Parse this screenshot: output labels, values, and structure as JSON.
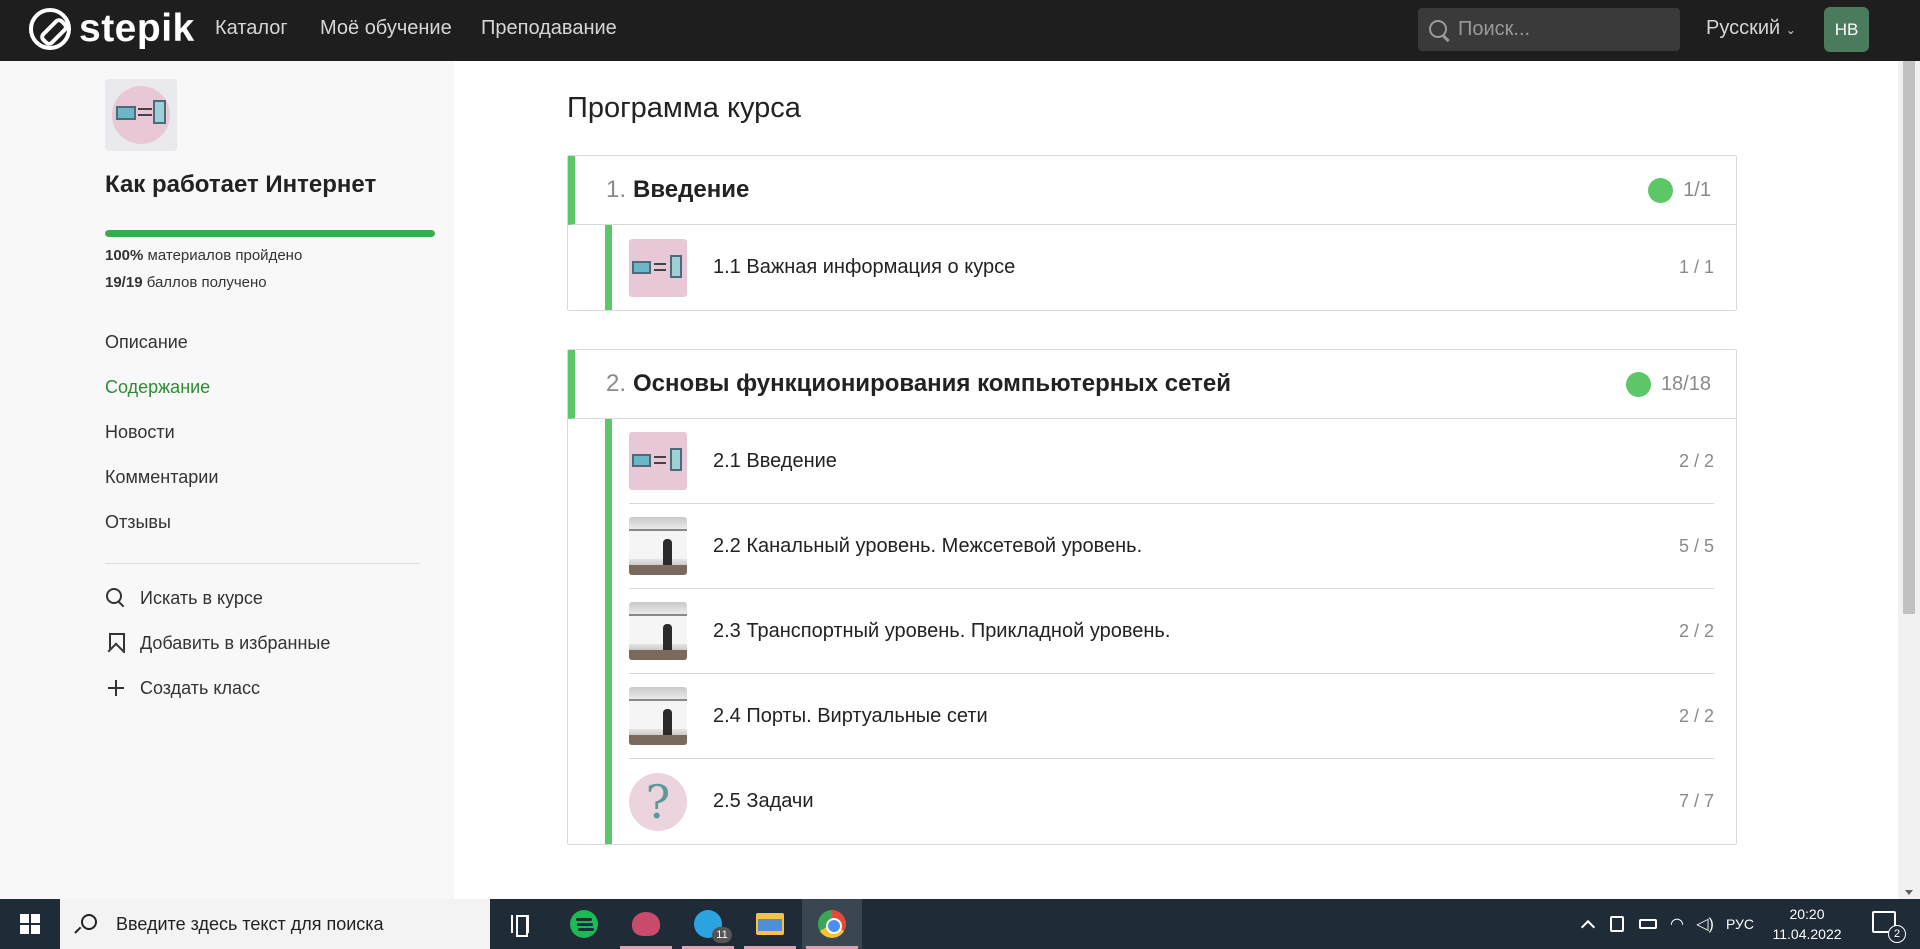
{
  "header": {
    "logo_text": "stepik",
    "nav": [
      "Каталог",
      "Моё обучение",
      "Преподавание"
    ],
    "search_placeholder": "Поиск...",
    "language": "Русский",
    "avatar_initials": "НВ"
  },
  "sidebar": {
    "course_title": "Как работает Интернет",
    "progress_percent": 100,
    "materials_value": "100%",
    "materials_text": "материалов пройдено",
    "score_value": "19/19",
    "score_text": "баллов получено",
    "links": [
      "Описание",
      "Содержание",
      "Новости",
      "Комментарии",
      "Отзывы"
    ],
    "active_link": "Содержание",
    "actions": [
      "Искать в курсе",
      "Добавить в избранные",
      "Создать класс"
    ]
  },
  "main": {
    "title": "Программа курса",
    "modules": [
      {
        "number": "1.",
        "title": "Введение",
        "score": "1/1",
        "lessons": [
          {
            "title": "1.1 Важная информация о курсе",
            "score": "1 / 1",
            "thumb": "course"
          }
        ]
      },
      {
        "number": "2.",
        "title": "Основы функционирования компьютерных сетей",
        "score": "18/18",
        "lessons": [
          {
            "title": "2.1 Введение",
            "score": "2 / 2",
            "thumb": "course"
          },
          {
            "title": "2.2 Канальный уровень. Межсетевой уровень.",
            "score": "5 / 5",
            "thumb": "video"
          },
          {
            "title": "2.3 Транспортный уровень. Прикладной уровень.",
            "score": "2 / 2",
            "thumb": "video"
          },
          {
            "title": "2.4 Порты. Виртуальные сети",
            "score": "2 / 2",
            "thumb": "video"
          },
          {
            "title": "2.5 Задачи",
            "score": "7 / 7",
            "thumb": "quiz"
          }
        ]
      }
    ]
  },
  "taskbar": {
    "search_text": "Введите здесь текст для поиска",
    "telegram_badge": "11",
    "lang_indicator": "РУС",
    "time": "20:20",
    "date": "11.04.2022",
    "notification_count": "2",
    "apps": [
      "task-view-icon",
      "spotify-icon",
      "snip-icon",
      "telegram-icon",
      "file-explorer-icon",
      "chrome-icon"
    ]
  },
  "colors": {
    "accent_green": "#5cc766",
    "active_link": "#2e8b33",
    "topbar": "#1e1e1e",
    "taskbar": "#1f2b36"
  }
}
